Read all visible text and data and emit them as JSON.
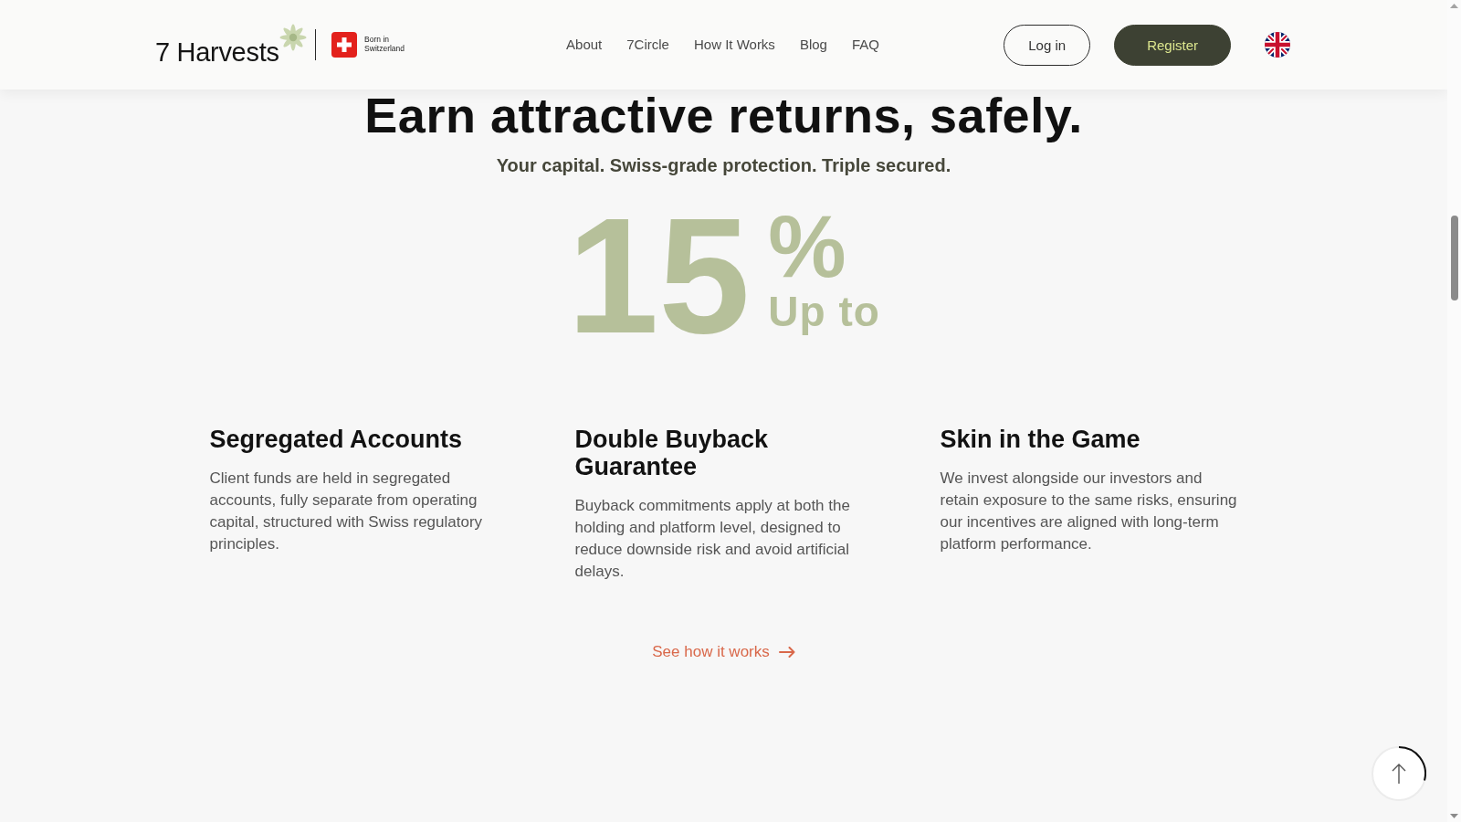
{
  "header": {
    "logo": "7 Harvests",
    "badge": "Born in Switzerland",
    "nav": [
      {
        "label": "About"
      },
      {
        "label": "7Circle"
      },
      {
        "label": "How It Works"
      },
      {
        "label": "Blog"
      },
      {
        "label": "FAQ"
      }
    ],
    "buttons": [
      {
        "label": "Log in",
        "kind": "outline"
      },
      {
        "label": "Register",
        "kind": "filled"
      }
    ]
  },
  "hero": {
    "title": "Earn attractive returns, safely.",
    "subtitle": "Your capital. Swiss-grade protection. Triple secured.",
    "stat": {
      "value": "15",
      "unit": "%",
      "caption": "Up to"
    }
  },
  "features": [
    {
      "title": "Segregated Accounts",
      "text": "Client funds are held in segregated accounts, fully separate from operating capital, structured with Swiss regulatory principles."
    },
    {
      "title": "Double Buyback Guarantee",
      "text": "Buyback commitments apply at both the holding and platform level, designed to reduce downside risk and avoid artificial delays."
    },
    {
      "title": "Skin in the Game",
      "text": "We invest alongside our investors and retain exposure to the same risks, ensuring our incentives are aligned with long-term platform performance."
    }
  ],
  "link": {
    "label": "See how it works"
  }
}
